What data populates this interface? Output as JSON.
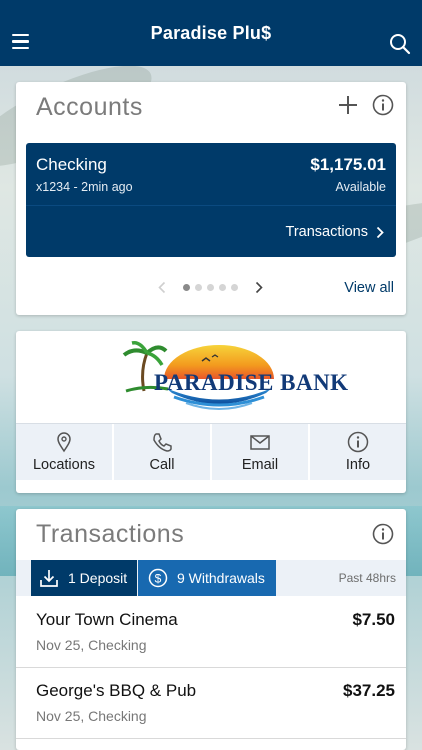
{
  "app": {
    "title": "Paradise Plu$"
  },
  "icons": {
    "menu": "hamburger-icon",
    "search": "search-icon",
    "add": "plus-icon",
    "info": "info-icon",
    "location": "location-pin-icon",
    "call": "phone-icon",
    "email": "envelope-icon",
    "deposit": "download-tray-icon",
    "withdrawal": "dollar-circle-icon"
  },
  "colors": {
    "brand": "#003a69",
    "accent": "#1869b0"
  },
  "accounts": {
    "title": "Accounts",
    "current": {
      "name": "Checking",
      "sub": "x1234 - 2min ago",
      "balance": "$1,175.01",
      "balance_label": "Available",
      "transactions_link": "Transactions"
    },
    "pager": {
      "count": 5,
      "active": 1
    },
    "view_all": "View all"
  },
  "bank": {
    "logo_text": "PARADISE BANK",
    "actions": [
      {
        "label": "Locations"
      },
      {
        "label": "Call"
      },
      {
        "label": "Email"
      },
      {
        "label": "Info"
      }
    ]
  },
  "transactions": {
    "title": "Transactions",
    "tabs": [
      {
        "label": "1 Deposit"
      },
      {
        "label": "9 Withdrawals"
      }
    ],
    "range": "Past 48hrs",
    "items": [
      {
        "merchant": "Your Town Cinema",
        "meta": "Nov 25, Checking",
        "amount": "$7.50"
      },
      {
        "merchant": "George's BBQ & Pub",
        "meta": "Nov 25, Checking",
        "amount": "$37.25"
      }
    ]
  }
}
